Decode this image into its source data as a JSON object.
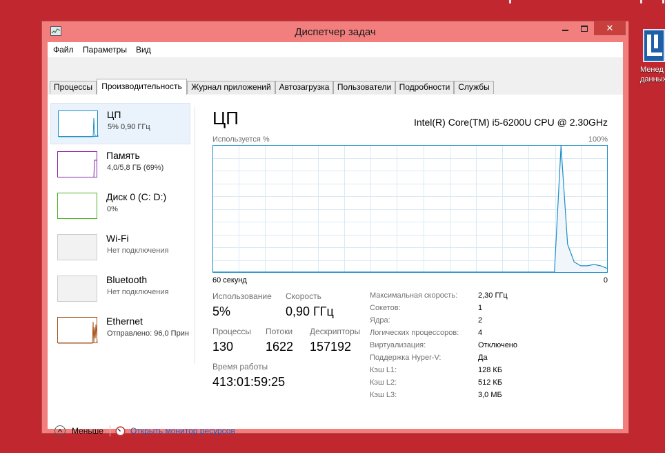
{
  "window": {
    "title": "Диспетчер задач",
    "close_glyph": "✕"
  },
  "menu": [
    "Файл",
    "Параметры",
    "Вид"
  ],
  "tabs": [
    "Процессы",
    "Производительность",
    "Журнал приложений",
    "Автозагрузка",
    "Пользователи",
    "Подробности",
    "Службы"
  ],
  "active_tab": "Производительность",
  "resources": [
    {
      "name": "ЦП",
      "detail": "5% 0,90 ГГц",
      "graph_color": "#1b8ec7",
      "icon": "cpu-graph"
    },
    {
      "name": "Память",
      "detail": "4,0/5,8 ГБ (69%)",
      "graph_color": "#8b22a6",
      "icon": "memory-graph"
    },
    {
      "name": "Диск 0 (C: D:)",
      "detail": "0%",
      "graph_color": "#4caf1e",
      "icon": "disk-graph"
    },
    {
      "name": "Wi-Fi",
      "detail": "Нет подключения",
      "graph_color": "#cccccc",
      "icon": "wifi-graph"
    },
    {
      "name": "Bluetooth",
      "detail": "Нет подключения",
      "graph_color": "#cccccc",
      "icon": "bluetooth-graph"
    },
    {
      "name": "Ethernet",
      "detail": "Отправлено: 96,0 Прин",
      "graph_color": "#a7521a",
      "icon": "ethernet-graph"
    }
  ],
  "detail": {
    "title": "ЦП",
    "model": "Intel(R) Core(TM) i5-6200U CPU @ 2.30GHz",
    "chart_label_top_left": "Используется %",
    "chart_label_top_right": "100%",
    "chart_label_bottom_left": "60 секунд",
    "chart_label_bottom_right": "0",
    "stats": {
      "usage_label": "Использование",
      "usage_value": "5%",
      "speed_label": "Скорость",
      "speed_value": "0,90 ГГц",
      "processes_label": "Процессы",
      "processes_value": "130",
      "threads_label": "Потоки",
      "threads_value": "1622",
      "handles_label": "Дескрипторы",
      "handles_value": "157192",
      "uptime_label": "Время работы",
      "uptime_value": "413:01:59:25"
    },
    "specs": [
      {
        "key": "Максимальная скорость:",
        "value": "2,30 ГГц"
      },
      {
        "key": "Сокетов:",
        "value": "1"
      },
      {
        "key": "Ядра:",
        "value": "2"
      },
      {
        "key": "Логических процессоров:",
        "value": "4"
      },
      {
        "key": "Виртуализация:",
        "value": "Отключено"
      },
      {
        "key": "Поддержка Hyper-V:",
        "value": "Да"
      },
      {
        "key": "Кэш L1:",
        "value": "128 КБ"
      },
      {
        "key": "Кэш L2:",
        "value": "512 КБ"
      },
      {
        "key": "Кэш L3:",
        "value": "3,0 МБ"
      }
    ]
  },
  "chart_data": {
    "type": "area",
    "x": [
      60,
      55,
      50,
      45,
      40,
      35,
      30,
      25,
      20,
      15,
      10,
      8,
      7,
      6,
      5,
      4,
      3,
      2,
      1,
      0
    ],
    "values": [
      0,
      0,
      0,
      0,
      0,
      0,
      0,
      0,
      0,
      0,
      0,
      0,
      100,
      22,
      8,
      5,
      5,
      6,
      5,
      3
    ],
    "ylim": [
      0,
      100
    ],
    "xlim": [
      60,
      0
    ],
    "grid": true,
    "line_color": "#1b8ec7",
    "fill_color": "#f1f6fa"
  },
  "footer": {
    "less_label": "Меньше",
    "monitor_link": "Открыть монитор ресурсов"
  },
  "desktop": {
    "shortcut_label_1": "Менед",
    "shortcut_label_2": "данных"
  }
}
